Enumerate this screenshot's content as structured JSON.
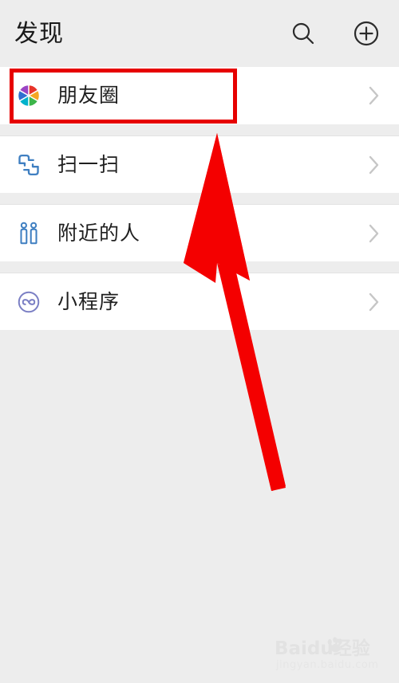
{
  "header": {
    "title": "发现",
    "search_icon": "search-icon",
    "add_icon": "plus-circle-icon"
  },
  "list": {
    "items": [
      {
        "label": "朋友圈",
        "icon": "moments-aperture-icon",
        "chevron": "chevron-right-icon",
        "highlighted": "true"
      },
      {
        "label": "扫一扫",
        "icon": "scan-qr-icon",
        "chevron": "chevron-right-icon",
        "highlighted": "false"
      },
      {
        "label": "附近的人",
        "icon": "people-nearby-icon",
        "chevron": "chevron-right-icon",
        "highlighted": "false"
      },
      {
        "label": "小程序",
        "icon": "mini-program-icon",
        "chevron": "chevron-right-icon",
        "highlighted": "false"
      }
    ]
  },
  "annotation": {
    "highlight_color": "#e60000",
    "arrow_color": "#f40000",
    "arrow_name": "red-pointer-arrow",
    "highlight_target": "朋友圈"
  },
  "watermark": {
    "main": "Baidu经验",
    "sub": "jingyan.baidu.com"
  },
  "colors": {
    "page_background": "#ededed",
    "row_background": "#ffffff",
    "label_text": "#1f1f1f",
    "chevron": "#c8c8c8",
    "scan_blue": "#3f7fc1",
    "people_blue": "#3f7fc1",
    "miniprogram_purple": "#7b7fc4"
  }
}
